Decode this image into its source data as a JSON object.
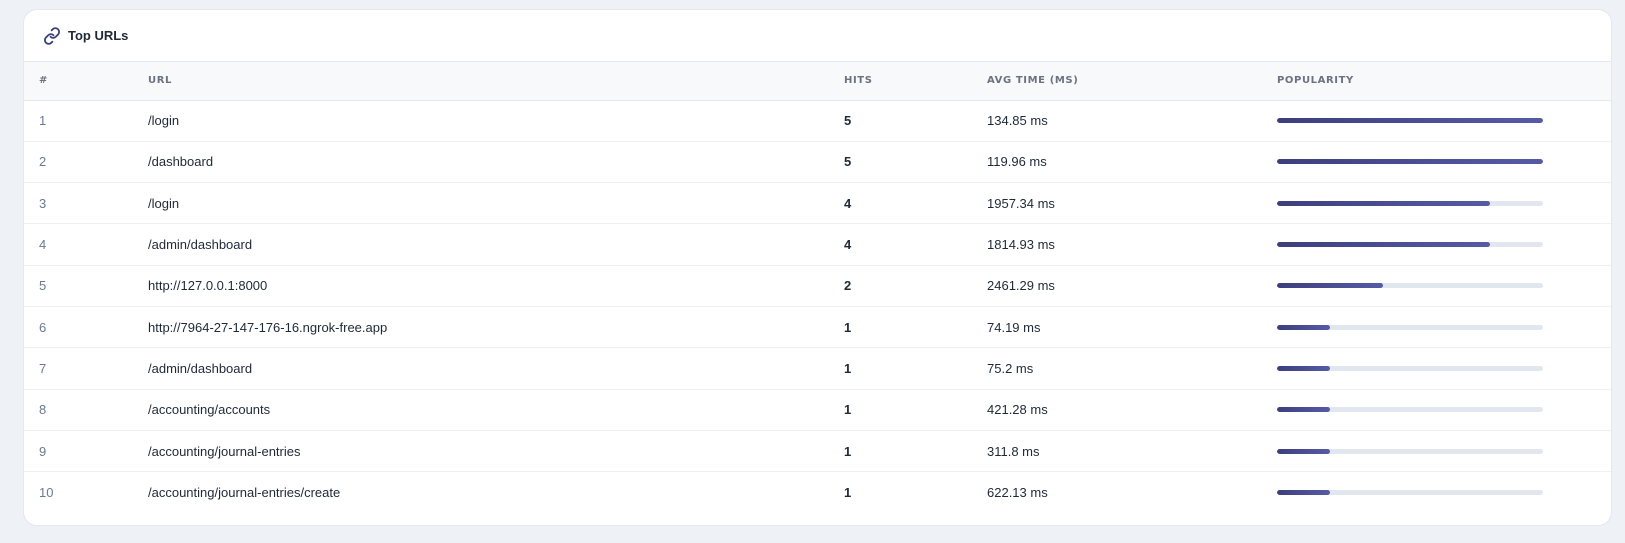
{
  "header": {
    "title": "Top URLs",
    "icon": "link-icon"
  },
  "table": {
    "columns": [
      "#",
      "URL",
      "HITS",
      "AVG TIME (MS)",
      "POPULARITY"
    ],
    "rows": [
      {
        "rank": "1",
        "url": "/login",
        "hits": "5",
        "avg": "134.85 ms",
        "popularity": 1.0
      },
      {
        "rank": "2",
        "url": "/dashboard",
        "hits": "5",
        "avg": "119.96 ms",
        "popularity": 1.0
      },
      {
        "rank": "3",
        "url": "/login",
        "hits": "4",
        "avg": "1957.34 ms",
        "popularity": 0.8
      },
      {
        "rank": "4",
        "url": "/admin/dashboard",
        "hits": "4",
        "avg": "1814.93 ms",
        "popularity": 0.8
      },
      {
        "rank": "5",
        "url": "http://127.0.0.1:8000",
        "hits": "2",
        "avg": "2461.29 ms",
        "popularity": 0.4
      },
      {
        "rank": "6",
        "url": "http://7964-27-147-176-16.ngrok-free.app",
        "hits": "1",
        "avg": "74.19 ms",
        "popularity": 0.2
      },
      {
        "rank": "7",
        "url": "/admin/dashboard",
        "hits": "1",
        "avg": "75.2 ms",
        "popularity": 0.2
      },
      {
        "rank": "8",
        "url": "/accounting/accounts",
        "hits": "1",
        "avg": "421.28 ms",
        "popularity": 0.2
      },
      {
        "rank": "9",
        "url": "/accounting/journal-entries",
        "hits": "1",
        "avg": "311.8 ms",
        "popularity": 0.2
      },
      {
        "rank": "10",
        "url": "/accounting/journal-entries/create",
        "hits": "1",
        "avg": "622.13 ms",
        "popularity": 0.2
      }
    ]
  },
  "colors": {
    "bar_fill": "#4a4d93",
    "bar_track": "#e2e6ee",
    "accent_icon": "#3b3f7a"
  }
}
